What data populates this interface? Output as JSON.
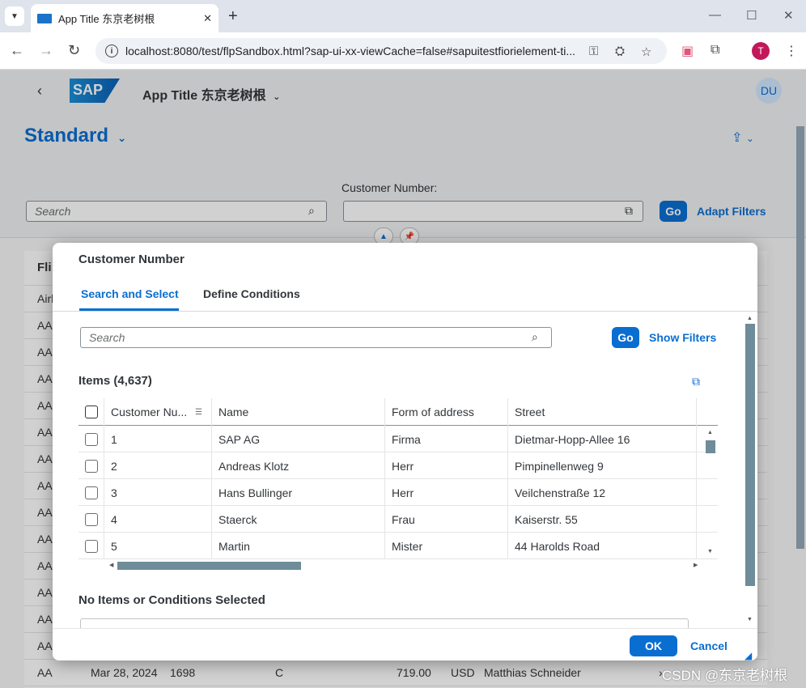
{
  "browser": {
    "tab_title": "App Title 东京老树根",
    "url": "localhost:8080/test/flpSandbox.html?sap-ui-xx-viewCache=false#sapuitestfiorielement-ti...",
    "profile_initial": "T"
  },
  "shell": {
    "logo_text": "SAP",
    "app_title": "App Title 东京老树根",
    "user_initials": "DU"
  },
  "header": {
    "variant": "Standard",
    "search_placeholder": "Search",
    "filter_label": "Customer Number:",
    "go_label": "Go",
    "adapt_filters_label": "Adapt Filters"
  },
  "background_table": {
    "header_cut": "Fli",
    "col_cut": "Airl",
    "row_value": "AA",
    "last_row": {
      "airline": "AA",
      "date": "Mar 28, 2024",
      "number": "1698",
      "class": "C",
      "amount": "719.00",
      "currency": "USD",
      "customer": "Matthias Schneider"
    }
  },
  "dialog": {
    "title": "Customer Number",
    "tabs": [
      "Search and Select",
      "Define Conditions"
    ],
    "search_placeholder": "Search",
    "go_label": "Go",
    "show_filters_label": "Show Filters",
    "items_title": "Items (4,637)",
    "columns": [
      "Customer Nu...",
      "Name",
      "Form of address",
      "Street"
    ],
    "rows": [
      {
        "id": "1",
        "name": "SAP AG",
        "form": "Firma",
        "street": "Dietmar-Hopp-Allee 16"
      },
      {
        "id": "2",
        "name": "Andreas Klotz",
        "form": "Herr",
        "street": "Pimpinellenweg 9"
      },
      {
        "id": "3",
        "name": "Hans Bullinger",
        "form": "Herr",
        "street": "Veilchenstraße 12"
      },
      {
        "id": "4",
        "name": "Staerck",
        "form": "Frau",
        "street": "Kaiserstr. 55"
      },
      {
        "id": "5",
        "name": "Martin",
        "form": "Mister",
        "street": "44 Harolds Road"
      }
    ],
    "no_selection_label": "No Items or Conditions Selected",
    "ok_label": "OK",
    "cancel_label": "Cancel"
  },
  "watermark": "CSDN @东京老树根",
  "colors": {
    "accent": "#0a6ed1",
    "shell_bg": "#eff1f2",
    "scrollbar": "#6e8c99"
  }
}
